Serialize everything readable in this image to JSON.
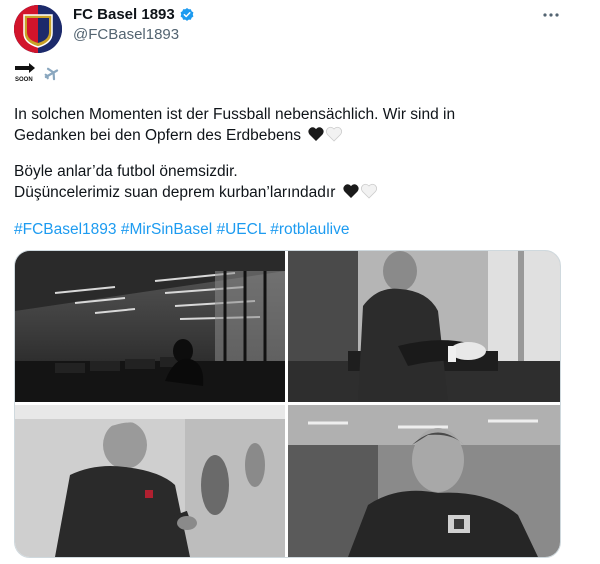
{
  "tweet": {
    "display_name": "FC Basel 1893",
    "handle": "@FCBasel1893",
    "soon_badge_text": "SOON",
    "line1": "In solchen Momenten ist der Fussball nebensächlich. Wir sind in",
    "line2": "Gedanken bei den Opfern des Erdbebens",
    "line3": "Böyle anlar’da futbol önemsizdir.",
    "line4": "Düşüncelerimiz suan deprem kurban’larındadır",
    "hashtags": [
      "#FCBasel1893",
      "#MirSinBasel",
      "#UECL",
      "#rotblaulive"
    ],
    "icons": {
      "avatar": "fc-basel-crest-icon",
      "verified": "verified-badge-icon",
      "more": "more-options-icon",
      "arrow": "arrow-right-icon",
      "plane": "airplane-icon",
      "heart_black": "black-heart-icon",
      "heart_white": "white-heart-icon"
    },
    "colors": {
      "link": "#1d9bf0",
      "verified": "#1d9bf0",
      "crest_red": "#d2142b",
      "crest_blue": "#1c2a6b"
    }
  }
}
